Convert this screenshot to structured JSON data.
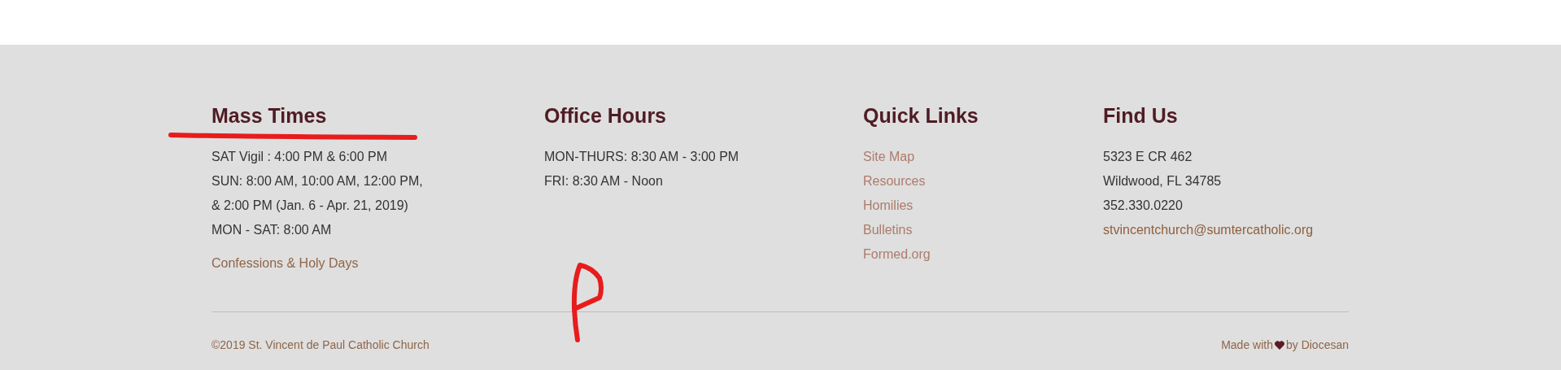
{
  "columns": [
    {
      "heading": "Mass Times",
      "items": [
        {
          "kind": "text",
          "text": "SAT Vigil : 4:00 PM & 6:00 PM"
        },
        {
          "kind": "text",
          "text": "SUN: 8:00 AM, 10:00 AM, 12:00 PM,"
        },
        {
          "kind": "text",
          "text": "& 2:00 PM (Jan. 6 - Apr. 21, 2019)"
        },
        {
          "kind": "text",
          "text": "MON - SAT: 8:00 AM"
        },
        {
          "kind": "link",
          "text": "Confessions & Holy Days"
        }
      ]
    },
    {
      "heading": "Office Hours",
      "items": [
        {
          "kind": "text",
          "text": "MON-THURS: 8:30 AM - 3:00 PM"
        },
        {
          "kind": "text",
          "text": "FRI: 8:30 AM - Noon"
        }
      ]
    },
    {
      "heading": "Quick Links",
      "items": [
        {
          "kind": "nav_link",
          "text": "Site Map"
        },
        {
          "kind": "nav_link",
          "text": "Resources"
        },
        {
          "kind": "nav_link",
          "text": "Homilies"
        },
        {
          "kind": "nav_link",
          "text": "Bulletins"
        },
        {
          "kind": "nav_link",
          "text": "Formed.org"
        }
      ]
    },
    {
      "heading": "Find Us",
      "items": [
        {
          "kind": "text",
          "text": "5323 E CR 462"
        },
        {
          "kind": "text",
          "text": "Wildwood, FL 34785"
        },
        {
          "kind": "text",
          "text": "352.330.0220"
        },
        {
          "kind": "email",
          "text": "stvincentchurch@sumtercatholic.org"
        }
      ]
    }
  ],
  "copyright": "©2019 St. Vincent de Paul Catholic Church",
  "credit": {
    "before": "Made with",
    "after": "by Diocesan"
  }
}
